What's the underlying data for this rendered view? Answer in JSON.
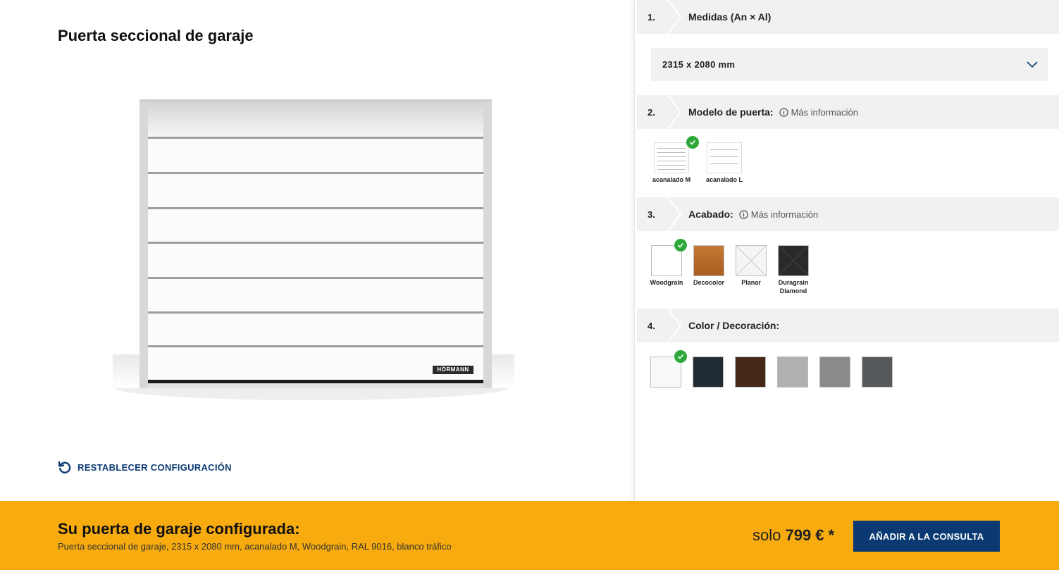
{
  "page": {
    "title": "Puerta seccional de garaje"
  },
  "door": {
    "brand": "HÖRMANN"
  },
  "reset": {
    "label": "RESTABLECER CONFIGURACIÓN"
  },
  "steps": [
    {
      "number": "1.",
      "title": "Medidas (An × Al)"
    },
    {
      "number": "2.",
      "title": "Modelo de puerta:",
      "info": "Más información"
    },
    {
      "number": "3.",
      "title": "Acabado:",
      "info": "Más información"
    },
    {
      "number": "4.",
      "title": "Color / Decoración:"
    }
  ],
  "size": {
    "value": "2315 x 2080 mm"
  },
  "models": [
    {
      "label": "acanalado M",
      "selected": true
    },
    {
      "label": "acanalado L",
      "selected": false
    }
  ],
  "finishes": [
    {
      "label": "Woodgrain",
      "color": "#ffffff",
      "selected": true
    },
    {
      "label": "Decocolor",
      "color": "#b86a2a",
      "selected": false
    },
    {
      "label": "Planar",
      "color": "#f2f2f2",
      "selected": false
    },
    {
      "label": "Duragrain Diamond",
      "color": "#2a2a2a",
      "selected": false
    }
  ],
  "colors": [
    {
      "name": "white",
      "color": "#f8f9fb",
      "selected": true
    },
    {
      "name": "anthracite-green",
      "color": "#1f2c33",
      "selected": false
    },
    {
      "name": "brown",
      "color": "#432916",
      "selected": false
    },
    {
      "name": "light-grey",
      "color": "#b0b0b0",
      "selected": false
    },
    {
      "name": "grey",
      "color": "#8a8a8a",
      "selected": false
    },
    {
      "name": "dark-grey",
      "color": "#55595c",
      "selected": false
    }
  ],
  "summary": {
    "title": "Su puerta de garaje configurada:",
    "description": "Puerta seccional de garaje, 2315 x 2080 mm, acanalado M, Woodgrain, RAL 9016, blanco tráfico",
    "price_prefix": "solo",
    "price": "799 €",
    "price_suffix": "*",
    "button": "AÑADIR A LA CONSULTA"
  },
  "colors_theme": {
    "accent_yellow": "#f7ab0e",
    "primary_blue": "#0b3a73",
    "check_green": "#2fa83a"
  }
}
